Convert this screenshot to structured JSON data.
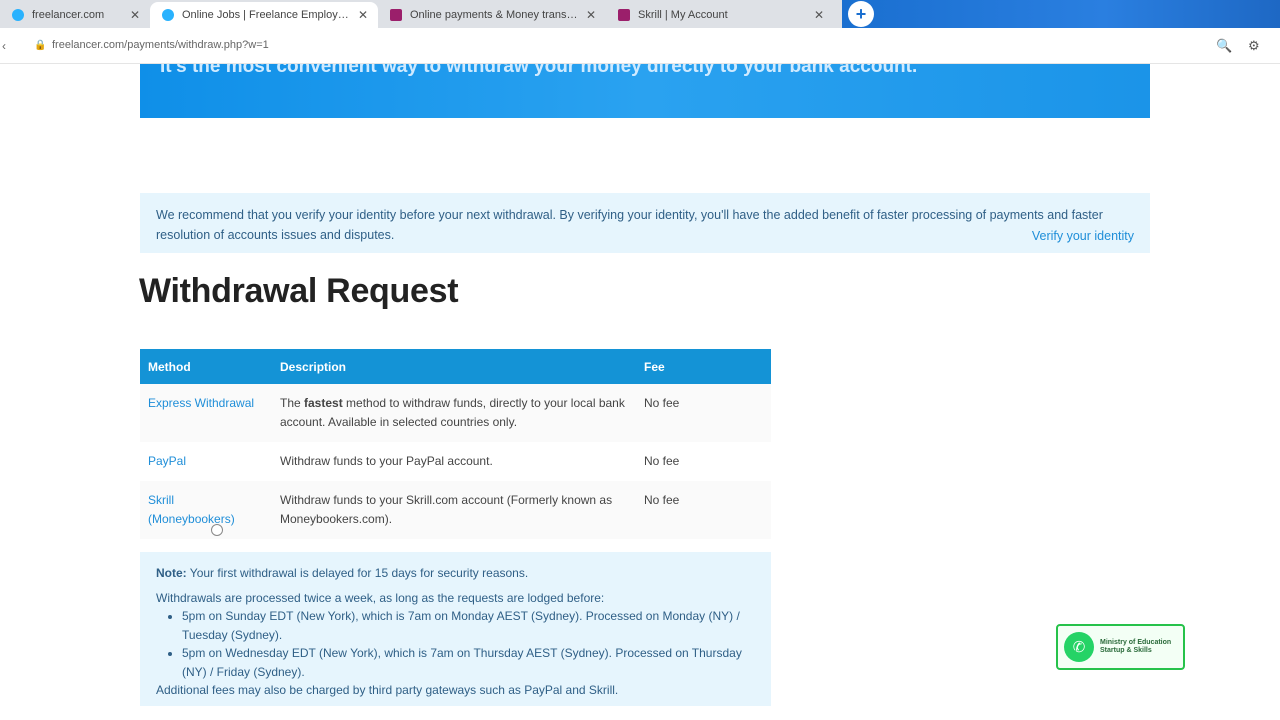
{
  "browser": {
    "tabs": [
      {
        "label": "freelancer.com",
        "favicon": "blue"
      },
      {
        "label": "Online Jobs | Freelance Employment",
        "favicon": "blue"
      },
      {
        "label": "Online payments & Money transfer",
        "favicon": "purple"
      },
      {
        "label": "Skrill | My Account",
        "favicon": "purple"
      }
    ],
    "new_tab_icon": "+",
    "url": "freelancer.com/payments/withdraw.php?w=1"
  },
  "banner": {
    "text": "It's the most convenient way to withdraw your money directly to your bank account."
  },
  "verify_notice": {
    "text": "We recommend that you verify your identity before your next withdrawal. By verifying your identity, you'll have the added benefit of faster processing of payments and faster resolution of accounts issues and disputes.",
    "link": "Verify your identity"
  },
  "page_title": "Withdrawal Request",
  "withdraw_table": {
    "headers": [
      "Method",
      "Description",
      "Fee"
    ],
    "rows": [
      {
        "method": "Express Withdrawal",
        "desc_bold": "fastest",
        "desc_prefix": "The ",
        "desc_suffix": " method to withdraw funds, directly to your local bank account. Available in selected countries only.",
        "fee": "No fee"
      },
      {
        "method": "PayPal",
        "desc": "Withdraw funds to your PayPal account.",
        "fee": "No fee"
      },
      {
        "method": "Skrill (Moneybookers)",
        "desc": "Withdraw funds to your Skrill.com account (Formerly known as Moneybookers.com).",
        "fee": "No fee"
      }
    ]
  },
  "note": {
    "label": "Note:",
    "first": " Your first withdrawal is delayed for 15 days for security reasons.",
    "intro": "Withdrawals are processed twice a week, as long as the requests are lodged before:",
    "items": [
      "5pm on Sunday EDT (New York), which is 7am on Monday AEST (Sydney). Processed on Monday (NY) / Tuesday (Sydney).",
      "5pm on Wednesday EDT (New York), which is 7am on Thursday AEST (Sydney). Processed on Thursday (NY) / Friday (Sydney)."
    ],
    "footer": "Additional fees may also be charged by third party gateways such as PayPal and Skrill."
  },
  "badge": {
    "text": "Ministry of Education Startup & Skills"
  }
}
